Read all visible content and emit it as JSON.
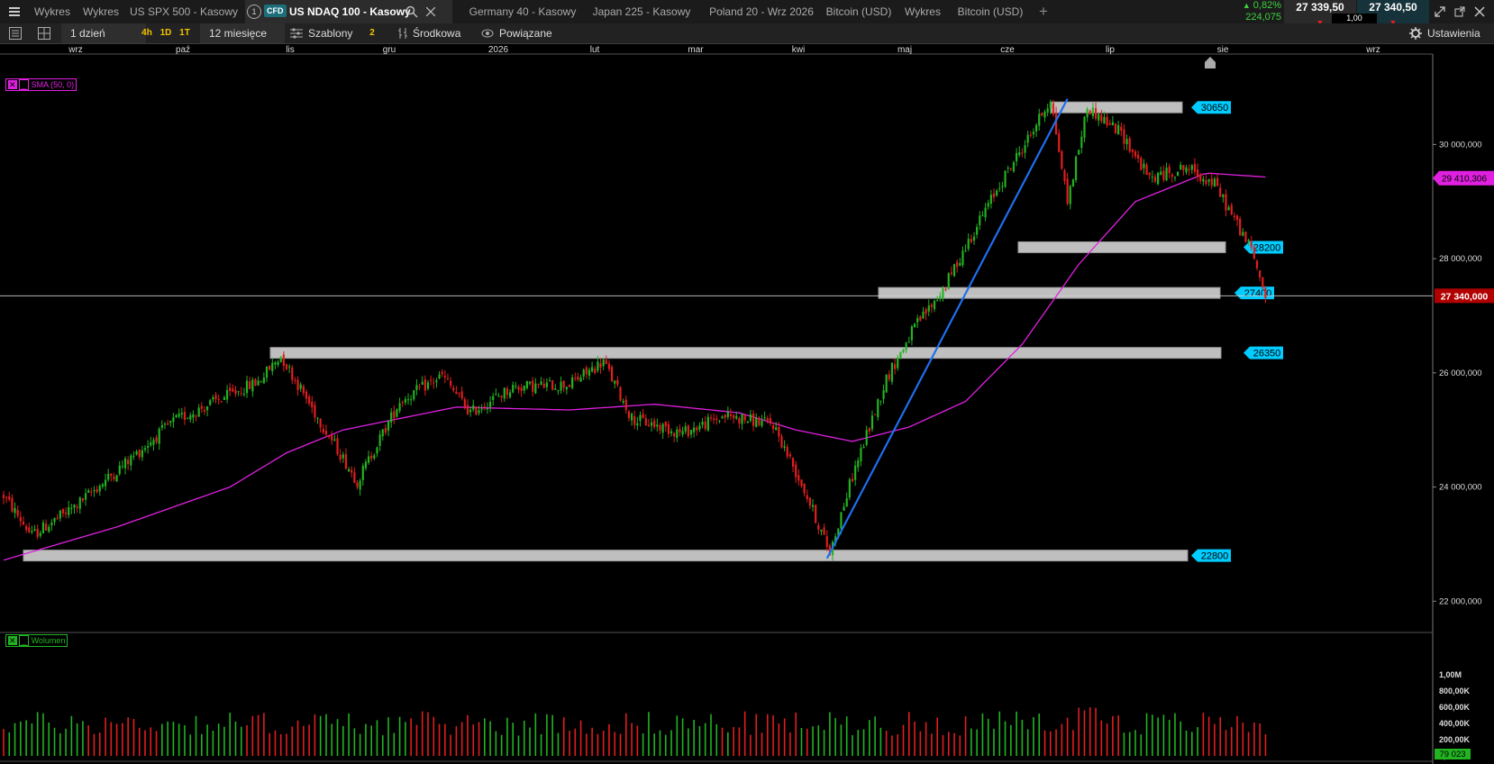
{
  "tabs": [
    {
      "label": "Wykres"
    },
    {
      "label": "Wykres"
    },
    {
      "label": "US SPX 500 - Kasowy"
    },
    {
      "label": "US NDAQ 100 - Kasowy",
      "active": true,
      "badge": "CFD",
      "num": "1"
    },
    {
      "label": "Germany 40 - Kasowy"
    },
    {
      "label": "Japan 225 - Kasowy"
    },
    {
      "label": "Poland 20 - Wrz 2026"
    },
    {
      "label": "Bitcoin (USD)"
    },
    {
      "label": "Wykres"
    },
    {
      "label": "Bitcoin (USD)"
    }
  ],
  "quote": {
    "change_pct": "0,82%",
    "change_abs": "224,075",
    "bid": "27 339,50",
    "ask": "27 340,50",
    "spread": "1,00"
  },
  "toolbar": {
    "interval": "1 dzień",
    "btn_4h": "4h",
    "btn_1d": "1D",
    "btn_1t": "1T",
    "range": "12 miesięce",
    "templates": "Szablony",
    "templates_count": "2",
    "mode": "Środkowa",
    "related": "Powiązane",
    "settings": "Ustawienia"
  },
  "colors": {
    "bull": "#22b322",
    "bear": "#e01e1e",
    "sma": "#e020e0",
    "trend": "#1e6ff0",
    "label_bg": "#00ccff",
    "current_bg": "#b10000"
  },
  "chart_data": {
    "type": "candlestick",
    "instrument": "US NDAQ 100 - Kasowy",
    "x_labels": [
      "wrz",
      "paź",
      "lis",
      "gru",
      "2026",
      "lut",
      "mar",
      "kwi",
      "maj",
      "cze",
      "lip",
      "sie",
      "wrz"
    ],
    "y_ticks": [
      "30 000,000",
      "28 000,000",
      "26 000,000",
      "24 000,000",
      "22 000,000"
    ],
    "ylim": [
      21500,
      31600
    ],
    "current_price": "27 340,000",
    "sma_value": "29 410,306",
    "sma_legend": "SMA (50, 0)",
    "levels": [
      {
        "label": "30650",
        "value": 30650
      },
      {
        "label": "28200",
        "value": 28200
      },
      {
        "label": "27400",
        "value": 27400
      },
      {
        "label": "26350",
        "value": 26350
      },
      {
        "label": "22800",
        "value": 22800
      }
    ],
    "keypoints": [
      {
        "t": 0,
        "p": 23850
      },
      {
        "t": 10,
        "p": 23150
      },
      {
        "t": 25,
        "p": 23650
      },
      {
        "t": 45,
        "p": 24500
      },
      {
        "t": 60,
        "p": 25150
      },
      {
        "t": 75,
        "p": 25500
      },
      {
        "t": 90,
        "p": 25850
      },
      {
        "t": 98,
        "p": 26300
      },
      {
        "t": 110,
        "p": 25300
      },
      {
        "t": 125,
        "p": 24100
      },
      {
        "t": 140,
        "p": 25500
      },
      {
        "t": 155,
        "p": 25950
      },
      {
        "t": 165,
        "p": 25300
      },
      {
        "t": 180,
        "p": 25750
      },
      {
        "t": 200,
        "p": 25800
      },
      {
        "t": 212,
        "p": 26200
      },
      {
        "t": 222,
        "p": 25200
      },
      {
        "t": 240,
        "p": 24950
      },
      {
        "t": 255,
        "p": 25250
      },
      {
        "t": 272,
        "p": 25100
      },
      {
        "t": 283,
        "p": 23950
      },
      {
        "t": 292,
        "p": 22850
      },
      {
        "t": 300,
        "p": 24200
      },
      {
        "t": 312,
        "p": 25900
      },
      {
        "t": 322,
        "p": 26800
      },
      {
        "t": 332,
        "p": 27450
      },
      {
        "t": 342,
        "p": 28400
      },
      {
        "t": 352,
        "p": 29300
      },
      {
        "t": 362,
        "p": 30100
      },
      {
        "t": 370,
        "p": 30800
      },
      {
        "t": 376,
        "p": 29000
      },
      {
        "t": 383,
        "p": 30650
      },
      {
        "t": 395,
        "p": 30200
      },
      {
        "t": 405,
        "p": 29400
      },
      {
        "t": 418,
        "p": 29600
      },
      {
        "t": 428,
        "p": 29300
      },
      {
        "t": 436,
        "p": 28600
      },
      {
        "t": 441,
        "p": 28150
      },
      {
        "t": 446,
        "p": 27350
      }
    ],
    "sma": [
      {
        "t": 0,
        "p": 22720
      },
      {
        "t": 40,
        "p": 23300
      },
      {
        "t": 80,
        "p": 24000
      },
      {
        "t": 100,
        "p": 24600
      },
      {
        "t": 120,
        "p": 25000
      },
      {
        "t": 160,
        "p": 25400
      },
      {
        "t": 200,
        "p": 25350
      },
      {
        "t": 230,
        "p": 25450
      },
      {
        "t": 260,
        "p": 25300
      },
      {
        "t": 280,
        "p": 25000
      },
      {
        "t": 300,
        "p": 24800
      },
      {
        "t": 320,
        "p": 25050
      },
      {
        "t": 340,
        "p": 25500
      },
      {
        "t": 360,
        "p": 26500
      },
      {
        "t": 380,
        "p": 27900
      },
      {
        "t": 400,
        "p": 29000
      },
      {
        "t": 425,
        "p": 29500
      },
      {
        "t": 446,
        "p": 29430
      }
    ],
    "trendline": [
      {
        "t": 291,
        "p": 22750
      },
      {
        "t": 376,
        "p": 30800
      }
    ],
    "volume_legend": "Wolumen",
    "volume_ticks": [
      "1,00M",
      "800,00K",
      "600,00K",
      "400,00K",
      "200,00K",
      "0,00"
    ],
    "volume_last": "79 023"
  }
}
